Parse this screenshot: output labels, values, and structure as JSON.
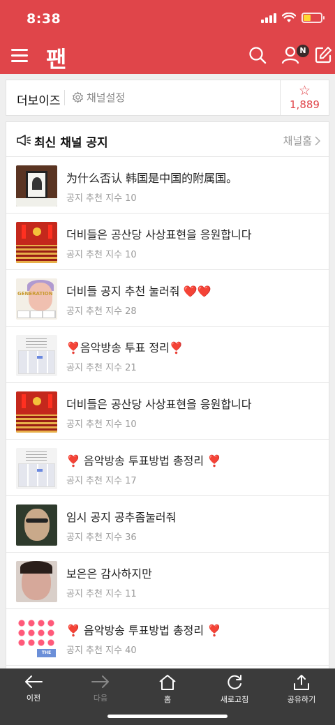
{
  "status_bar": {
    "time": "8:38",
    "signal": "signal-icon",
    "wifi": "wifi-icon",
    "battery": "battery-icon",
    "battery_level": 0.4
  },
  "app_header": {
    "logo": "팬",
    "icons": [
      "menu-icon",
      "search-icon",
      "user-icon",
      "write-icon"
    ],
    "user_badge": "N",
    "colors": {
      "brand": "#e0454a",
      "badge": "#3a2a2a"
    }
  },
  "channel": {
    "name": "더보이즈",
    "settings_label": "채널설정",
    "favorite_count": "1,889"
  },
  "notice": {
    "title": "최신 채널 공지",
    "home_link": "채널홈",
    "items": [
      {
        "title": "为什么否认 韩国是中国的附属国。",
        "meta": "공지 추천 지수 10",
        "thumb": "funeral-photo"
      },
      {
        "title": "더비들은 공산당 사상표현을 응원합니다",
        "meta": "공지 추천 지수 10",
        "thumb": "congress-hall"
      },
      {
        "title": "더비들 공지 추천 눌러줘 ",
        "hearts": "❤️❤️",
        "meta": "공지 추천 지수 28",
        "thumb": "idol-photo"
      },
      {
        "title": "❣️음악방송 투표 정리❣️",
        "meta": "공지 추천 지수 21",
        "thumb": "document-screenshot"
      },
      {
        "title": "더비들은 공산당 사상표현을 응원합니다",
        "meta": "공지 추천 지수 10",
        "thumb": "congress-hall"
      },
      {
        "title": "❣️ 음악방송 투표방법 총정리 ❣️",
        "meta": "공지 추천 지수 17",
        "thumb": "document-screenshot"
      },
      {
        "title": "임시 공지 공추좀눌러줘",
        "meta": "공지 추천 지수 36",
        "thumb": "man-photo"
      },
      {
        "title": "보은은 감사하지만",
        "meta": "공지 추천 지수 11",
        "thumb": "crying-face"
      },
      {
        "title": "❣️ 음악방송 투표방법 총정리 ❣️",
        "meta": "공지 추천 지수 40",
        "thumb": "app-icons"
      }
    ]
  },
  "toolbar": {
    "back": "이전",
    "forward": "다음",
    "home": "홈",
    "refresh": "새로고침",
    "share": "공유하기"
  }
}
